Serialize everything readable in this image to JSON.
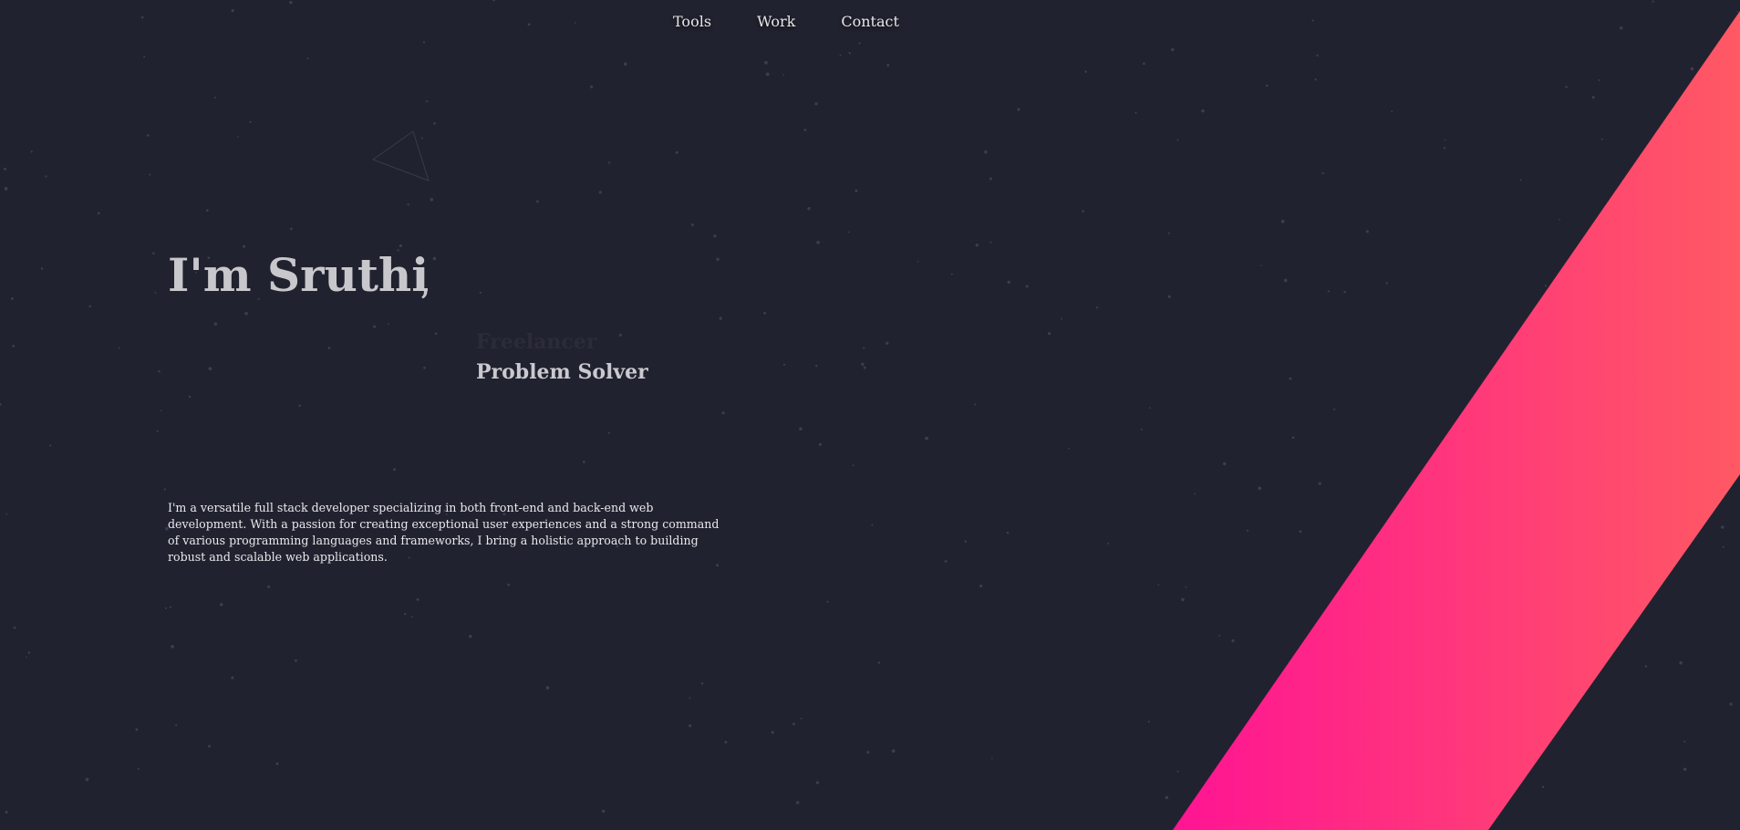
{
  "nav": {
    "items": [
      {
        "label": "Tools"
      },
      {
        "label": "Work"
      },
      {
        "label": "Contact"
      }
    ]
  },
  "hero": {
    "title": "I'm Sruthi",
    "comma": ",",
    "roles": {
      "previous": "Freelancer",
      "current": "Problem Solver"
    },
    "bio": "I'm a versatile full stack developer specializing in both front-end and back-end web development. With a passion for creating exceptional user experiences and a strong command of various programming languages and frameworks, I bring a holistic approach to building robust and scalable web applications."
  },
  "colors": {
    "background": "#21222f",
    "stripe_start": "#ff1493",
    "stripe_end": "#ff5964",
    "text": "#c7c7cc"
  }
}
